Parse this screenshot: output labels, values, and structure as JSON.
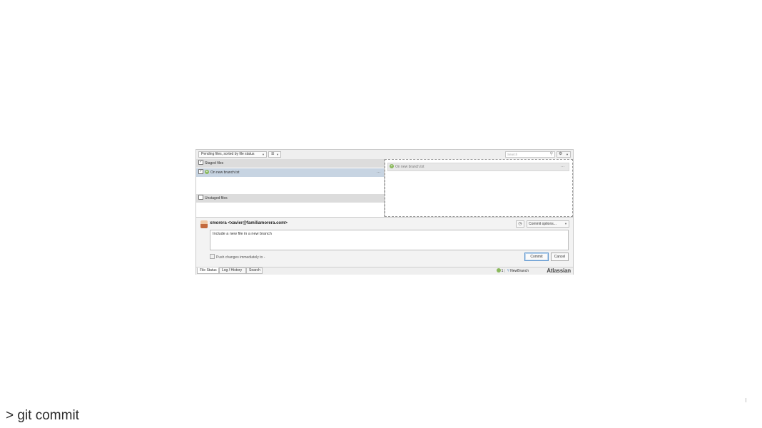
{
  "toolbar": {
    "view_select": "Pending files, sorted by file status",
    "list_mode_icon": "list-icon",
    "search_placeholder": "Search",
    "search_icon": "search-icon",
    "settings_icon": "gear-icon"
  },
  "staged": {
    "header": "Staged files",
    "files": [
      {
        "name": "On new branch.txt",
        "status_icon": "added-icon",
        "more": "···"
      }
    ]
  },
  "unstaged": {
    "header": "Unstaged files"
  },
  "diff": {
    "file_header": "On new branch.txt",
    "more": "···"
  },
  "commit": {
    "author": "xmorera <xavier@familiamorera.com>",
    "message": "Include a new file in a new branch",
    "history_icon": "clock-icon",
    "options_label": "Commit options...",
    "push_label": "Push changes immediately to -",
    "commit_button": "Commit",
    "cancel_button": "Cancel"
  },
  "statusbar": {
    "tabs": [
      "File Status",
      "Log / History",
      "Search"
    ],
    "pending_count": "1",
    "branch": "NewBranch",
    "brand": "Atlassian"
  },
  "caption": "> git commit"
}
